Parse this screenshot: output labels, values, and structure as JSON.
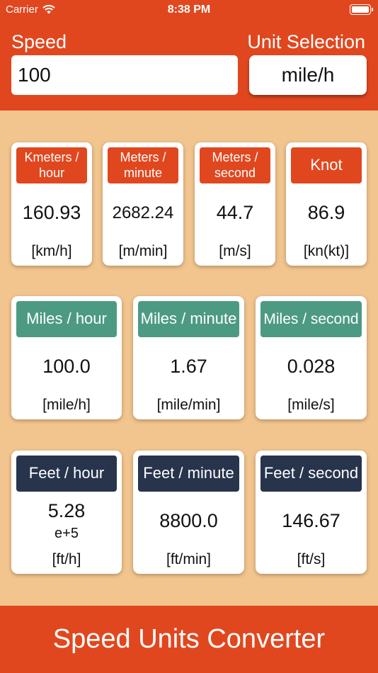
{
  "status": {
    "carrier": "Carrier",
    "time": "8:38 PM"
  },
  "header": {
    "speed_label": "Speed",
    "unit_label": "Unit Selection",
    "speed_value": "100",
    "unit_value": "mile/h"
  },
  "row1": [
    {
      "title": "Kmeters / hour",
      "value": "160.93",
      "unit": "[km/h]"
    },
    {
      "title": "Meters / minute",
      "value": "2682.24",
      "unit": "[m/min]"
    },
    {
      "title": "Meters / second",
      "value": "44.7",
      "unit": "[m/s]"
    },
    {
      "title": "Knot",
      "value": "86.9",
      "unit": "[kn(kt)]"
    }
  ],
  "row2": [
    {
      "title": "Miles / hour",
      "value": "100.0",
      "unit": "[mile/h]"
    },
    {
      "title": "Miles / minute",
      "value": "1.67",
      "unit": "[mile/min]"
    },
    {
      "title": "Miles / second",
      "value": "0.028",
      "unit": "[mile/s]"
    }
  ],
  "row3": [
    {
      "title": "Feet / hour",
      "value": "5.28",
      "value_exp": "e+5",
      "unit": "[ft/h]"
    },
    {
      "title": "Feet / minute",
      "value": "8800.0",
      "unit": "[ft/min]"
    },
    {
      "title": "Feet / second",
      "value": "146.67",
      "unit": "[ft/s]"
    }
  ],
  "footer": {
    "title": "Speed Units Converter"
  }
}
